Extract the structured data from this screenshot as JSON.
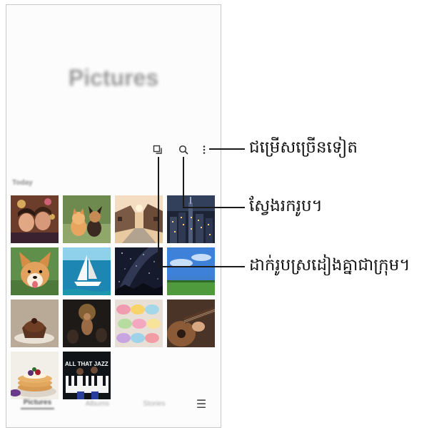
{
  "app": {
    "title": "Pictures"
  },
  "toolbar": {
    "select_icon": "select-icon",
    "search_icon": "search-icon",
    "more_icon": "more-options-icon"
  },
  "section": {
    "label": "Today"
  },
  "photos": [
    {
      "name": "photo-party-selfie",
      "subject": "party selfie"
    },
    {
      "name": "photo-kitten-puppy",
      "subject": "kitten and puppy"
    },
    {
      "name": "photo-village-street",
      "subject": "village street"
    },
    {
      "name": "photo-city-skyline",
      "subject": "city skyline at night"
    },
    {
      "name": "photo-corgi",
      "subject": "corgi"
    },
    {
      "name": "photo-sailboat",
      "subject": "sailboat"
    },
    {
      "name": "photo-starry-sky",
      "subject": "starry sky"
    },
    {
      "name": "photo-field-sky",
      "subject": "blue sky over field"
    },
    {
      "name": "photo-cupcake",
      "subject": "chocolate cupcake"
    },
    {
      "name": "photo-concert",
      "subject": "concert"
    },
    {
      "name": "photo-macarons",
      "subject": "macarons"
    },
    {
      "name": "photo-guitar",
      "subject": "guitar"
    },
    {
      "name": "photo-pancakes",
      "subject": "pancakes"
    },
    {
      "name": "photo-jazz-poster",
      "subject": "jazz poster",
      "text": "ALL THAT JAZZ"
    }
  ],
  "bottom_nav": {
    "tabs": [
      "Pictures",
      "Albums",
      "Stories"
    ],
    "menu_icon": "menu-icon"
  },
  "callouts": {
    "more_options": "ជម្រើសច្រើនទៀត",
    "search": "ស្វែងរករូប។",
    "group": "ដាក់រូបស្រដៀងគ្នាជាក្រុម។"
  },
  "colors": {
    "callout_text": "#111111",
    "leader_line": "#1a1a1a",
    "frame": "#c8c8c8"
  }
}
